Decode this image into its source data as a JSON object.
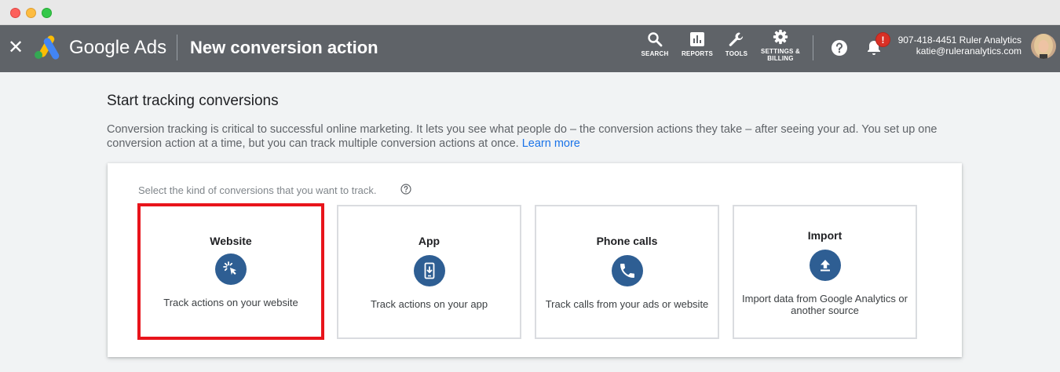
{
  "header": {
    "brand": "Google Ads",
    "page_title": "New conversion action",
    "nav": {
      "search": "SEARCH",
      "reports": "REPORTS",
      "tools": "TOOLS",
      "settings_line1": "SETTINGS &",
      "settings_line2": "BILLING"
    },
    "alert_count": "!",
    "account": {
      "phone_name": "907-418-4451 Ruler Analytics",
      "email": "katie@ruleranalytics.com"
    }
  },
  "main": {
    "title": "Start tracking conversions",
    "intro": "Conversion tracking is critical to successful online marketing. It lets you see what people do – the conversion actions they take – after seeing your ad. You set up one conversion action at a time, but you can track multiple conversion actions at once.",
    "learn_more": "Learn more",
    "instruction": "Select the kind of conversions that you want to track.",
    "options": [
      {
        "title": "Website",
        "description": "Track actions on your website",
        "icon": "cursor-click-icon",
        "selected": true
      },
      {
        "title": "App",
        "description": "Track actions on your app",
        "icon": "phone-download-icon",
        "selected": false
      },
      {
        "title": "Phone calls",
        "description": "Track calls from your ads or website",
        "icon": "phone-handset-icon",
        "selected": false
      },
      {
        "title": "Import",
        "description": "Import data from Google Analytics or another source",
        "icon": "upload-icon",
        "selected": false
      }
    ]
  },
  "colors": {
    "header_bg": "#5f6368",
    "icon_circle": "#2e5e93",
    "selected_border": "#e8141b",
    "link": "#1a73e8"
  }
}
